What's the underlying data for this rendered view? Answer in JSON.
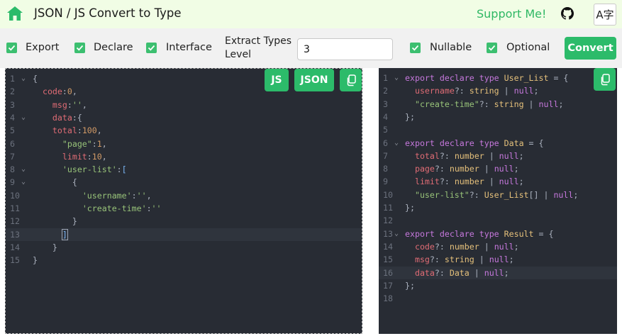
{
  "header": {
    "title": "JSON / JS Convert to Type",
    "support_label": "Support Me!",
    "lang_glyph": "A字"
  },
  "toolbar": {
    "export_label": "Export",
    "declare_label": "Declare",
    "interface_label": "Interface",
    "extract_label": "Extract Types Level",
    "level_value": "3",
    "nullable_label": "Nullable",
    "optional_label": "Optional",
    "convert_label": "Convert"
  },
  "left_editor": {
    "js_label": "JS",
    "json_label": "JSON",
    "active_line": 13,
    "lines": [
      {
        "n": "1",
        "fold": true,
        "t": [
          [
            "{",
            "pun"
          ]
        ]
      },
      {
        "n": "2",
        "fold": false,
        "t": [
          [
            "  ",
            "pun"
          ],
          [
            "code",
            "key"
          ],
          [
            ":",
            "pun"
          ],
          [
            "0",
            "num"
          ],
          [
            ",",
            "pun"
          ]
        ]
      },
      {
        "n": "3",
        "fold": false,
        "t": [
          [
            "    ",
            "pun"
          ],
          [
            "msg",
            "key"
          ],
          [
            ":",
            "pun"
          ],
          [
            "''",
            "str"
          ],
          [
            ",",
            "pun"
          ]
        ]
      },
      {
        "n": "4",
        "fold": true,
        "t": [
          [
            "    ",
            "pun"
          ],
          [
            "data",
            "key"
          ],
          [
            ":",
            "pun"
          ],
          [
            "{",
            "pun"
          ]
        ]
      },
      {
        "n": "5",
        "fold": false,
        "t": [
          [
            "    ",
            "pun"
          ],
          [
            "total",
            "key"
          ],
          [
            ":",
            "pun"
          ],
          [
            "100",
            "num"
          ],
          [
            ",",
            "pun"
          ]
        ]
      },
      {
        "n": "6",
        "fold": false,
        "t": [
          [
            "      ",
            "pun"
          ],
          [
            "\"page\"",
            "str"
          ],
          [
            ":",
            "pun"
          ],
          [
            "1",
            "num"
          ],
          [
            ",",
            "pun"
          ]
        ]
      },
      {
        "n": "7",
        "fold": false,
        "t": [
          [
            "      ",
            "pun"
          ],
          [
            "limit",
            "key"
          ],
          [
            ":",
            "pun"
          ],
          [
            "10",
            "num"
          ],
          [
            ",",
            "pun"
          ]
        ]
      },
      {
        "n": "8",
        "fold": true,
        "t": [
          [
            "      ",
            "pun"
          ],
          [
            "'user-list'",
            "str"
          ],
          [
            ":",
            "pun"
          ],
          [
            "[",
            "brc"
          ]
        ]
      },
      {
        "n": "9",
        "fold": true,
        "t": [
          [
            "        ",
            "pun"
          ],
          [
            "{",
            "pun"
          ]
        ]
      },
      {
        "n": "10",
        "fold": false,
        "t": [
          [
            "          ",
            "pun"
          ],
          [
            "'username'",
            "str"
          ],
          [
            ":",
            "pun"
          ],
          [
            "''",
            "str"
          ],
          [
            ",",
            "pun"
          ]
        ]
      },
      {
        "n": "11",
        "fold": false,
        "t": [
          [
            "          ",
            "pun"
          ],
          [
            "'create-time'",
            "str"
          ],
          [
            ":",
            "pun"
          ],
          [
            "''",
            "str"
          ]
        ]
      },
      {
        "n": "12",
        "fold": false,
        "t": [
          [
            "        ",
            "pun"
          ],
          [
            "}",
            "pun"
          ]
        ]
      },
      {
        "n": "13",
        "fold": false,
        "t": [
          [
            "      ",
            "pun"
          ],
          [
            "]",
            "brc"
          ]
        ]
      },
      {
        "n": "14",
        "fold": false,
        "t": [
          [
            "    ",
            "pun"
          ],
          [
            "}",
            "pun"
          ]
        ]
      },
      {
        "n": "15",
        "fold": false,
        "t": [
          [
            "}",
            "pun"
          ]
        ]
      }
    ]
  },
  "right_editor": {
    "active_line": 16,
    "lines": [
      {
        "n": "1",
        "fold": true,
        "t": [
          [
            "export",
            "kw"
          ],
          [
            " ",
            "pun"
          ],
          [
            "declare",
            "kw"
          ],
          [
            " ",
            "pun"
          ],
          [
            "type",
            "kw"
          ],
          [
            " ",
            "pun"
          ],
          [
            "User_List",
            "type"
          ],
          [
            " = {",
            "pun"
          ]
        ]
      },
      {
        "n": "2",
        "fold": false,
        "t": [
          [
            "  ",
            "pun"
          ],
          [
            "username",
            "key"
          ],
          [
            "?: ",
            "pun"
          ],
          [
            "string",
            "type"
          ],
          [
            " | ",
            "pun"
          ],
          [
            "null",
            "kw"
          ],
          [
            ";",
            "pun"
          ]
        ]
      },
      {
        "n": "3",
        "fold": false,
        "t": [
          [
            "  ",
            "pun"
          ],
          [
            "\"create-time\"",
            "str"
          ],
          [
            "?: ",
            "pun"
          ],
          [
            "string",
            "type"
          ],
          [
            " | ",
            "pun"
          ],
          [
            "null",
            "kw"
          ],
          [
            ";",
            "pun"
          ]
        ]
      },
      {
        "n": "4",
        "fold": false,
        "t": [
          [
            "};",
            "pun"
          ]
        ]
      },
      {
        "n": "5",
        "fold": false,
        "t": []
      },
      {
        "n": "6",
        "fold": true,
        "t": [
          [
            "export",
            "kw"
          ],
          [
            " ",
            "pun"
          ],
          [
            "declare",
            "kw"
          ],
          [
            " ",
            "pun"
          ],
          [
            "type",
            "kw"
          ],
          [
            " ",
            "pun"
          ],
          [
            "Data",
            "type"
          ],
          [
            " = {",
            "pun"
          ]
        ]
      },
      {
        "n": "7",
        "fold": false,
        "t": [
          [
            "  ",
            "pun"
          ],
          [
            "total",
            "key"
          ],
          [
            "?: ",
            "pun"
          ],
          [
            "number",
            "type"
          ],
          [
            " | ",
            "pun"
          ],
          [
            "null",
            "kw"
          ],
          [
            ";",
            "pun"
          ]
        ]
      },
      {
        "n": "8",
        "fold": false,
        "t": [
          [
            "  ",
            "pun"
          ],
          [
            "page",
            "key"
          ],
          [
            "?: ",
            "pun"
          ],
          [
            "number",
            "type"
          ],
          [
            " | ",
            "pun"
          ],
          [
            "null",
            "kw"
          ],
          [
            ";",
            "pun"
          ]
        ]
      },
      {
        "n": "9",
        "fold": false,
        "t": [
          [
            "  ",
            "pun"
          ],
          [
            "limit",
            "key"
          ],
          [
            "?: ",
            "pun"
          ],
          [
            "number",
            "type"
          ],
          [
            " | ",
            "pun"
          ],
          [
            "null",
            "kw"
          ],
          [
            ";",
            "pun"
          ]
        ]
      },
      {
        "n": "10",
        "fold": false,
        "t": [
          [
            "  ",
            "pun"
          ],
          [
            "\"user-list\"",
            "str"
          ],
          [
            "?: ",
            "pun"
          ],
          [
            "User_List",
            "type"
          ],
          [
            "[] | ",
            "pun"
          ],
          [
            "null",
            "kw"
          ],
          [
            ";",
            "pun"
          ]
        ]
      },
      {
        "n": "11",
        "fold": false,
        "t": [
          [
            "};",
            "pun"
          ]
        ]
      },
      {
        "n": "12",
        "fold": false,
        "t": []
      },
      {
        "n": "13",
        "fold": true,
        "t": [
          [
            "export",
            "kw"
          ],
          [
            " ",
            "pun"
          ],
          [
            "declare",
            "kw"
          ],
          [
            " ",
            "pun"
          ],
          [
            "type",
            "kw"
          ],
          [
            " ",
            "pun"
          ],
          [
            "Result",
            "type"
          ],
          [
            " = {",
            "pun"
          ]
        ]
      },
      {
        "n": "14",
        "fold": false,
        "t": [
          [
            "  ",
            "pun"
          ],
          [
            "code",
            "key"
          ],
          [
            "?: ",
            "pun"
          ],
          [
            "number",
            "type"
          ],
          [
            " | ",
            "pun"
          ],
          [
            "null",
            "kw"
          ],
          [
            ";",
            "pun"
          ]
        ]
      },
      {
        "n": "15",
        "fold": false,
        "t": [
          [
            "  ",
            "pun"
          ],
          [
            "msg",
            "key"
          ],
          [
            "?: ",
            "pun"
          ],
          [
            "string",
            "type"
          ],
          [
            " | ",
            "pun"
          ],
          [
            "null",
            "kw"
          ],
          [
            ";",
            "pun"
          ]
        ]
      },
      {
        "n": "16",
        "fold": false,
        "t": [
          [
            "  ",
            "pun"
          ],
          [
            "data",
            "key"
          ],
          [
            "?: ",
            "pun"
          ],
          [
            "Data",
            "type"
          ],
          [
            " | ",
            "pun"
          ],
          [
            "null",
            "kw"
          ],
          [
            ";",
            "pun"
          ]
        ]
      },
      {
        "n": "17",
        "fold": false,
        "t": [
          [
            "};",
            "pun"
          ]
        ]
      },
      {
        "n": "18",
        "fold": false,
        "t": []
      }
    ]
  },
  "colors": {
    "accent": "#2cbb6a",
    "header_bg": "#f1fde5",
    "editor_bg": "#282c34"
  }
}
